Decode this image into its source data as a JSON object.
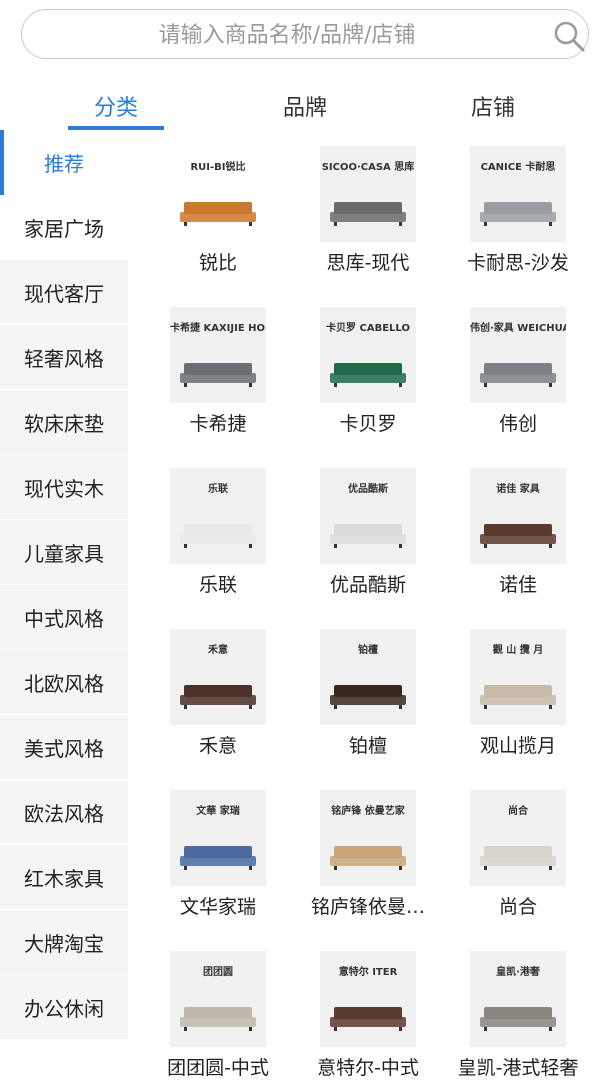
{
  "search": {
    "placeholder": "请输入商品名称/品牌/店铺",
    "value": ""
  },
  "tabs": [
    {
      "label": "分类",
      "active": true
    },
    {
      "label": "品牌",
      "active": false
    },
    {
      "label": "店铺",
      "active": false
    }
  ],
  "colors": {
    "accent": "#2d7bd6",
    "sidebar_bg": "#f5f5f5",
    "thumb_bg": "#f1f1f1"
  },
  "sidebar": {
    "items": [
      {
        "label": "推荐"
      },
      {
        "label": "家居广场"
      },
      {
        "label": "现代客厅"
      },
      {
        "label": "轻奢风格"
      },
      {
        "label": "软床床垫"
      },
      {
        "label": "现代实木"
      },
      {
        "label": "儿童家具"
      },
      {
        "label": "中式风格"
      },
      {
        "label": "北欧风格"
      },
      {
        "label": "美式风格"
      },
      {
        "label": "欧法风格"
      },
      {
        "label": "红木家具"
      },
      {
        "label": "大牌淘宝"
      },
      {
        "label": "办公休闲"
      }
    ]
  },
  "brands": [
    {
      "name": "锐比",
      "logo": "RUI-BI锐比",
      "sofa_color": "#c9782e"
    },
    {
      "name": "思库-现代",
      "logo": "SICOO·CASA 思库",
      "sofa_color": "#6a6a6a"
    },
    {
      "name": "卡耐思-沙发",
      "logo": "CANICE 卡耐思",
      "sofa_color": "#9a9ea2"
    },
    {
      "name": "卡希捷",
      "logo": "卡希捷 KAXIJIE HOME",
      "sofa_color": "#6b6e72"
    },
    {
      "name": "卡贝罗",
      "logo": "卡贝罗 CABELLO",
      "sofa_color": "#1d6b4a"
    },
    {
      "name": "伟创",
      "logo": "伟创·家具 WEICHUANG",
      "sofa_color": "#7d8086"
    },
    {
      "name": "乐联",
      "logo": "乐联",
      "sofa_color": "#e9e9e9"
    },
    {
      "name": "优品酷斯",
      "logo": "优品酷斯",
      "sofa_color": "#dcdcdc"
    },
    {
      "name": "诺佳",
      "logo": "诺佳 家具",
      "sofa_color": "#5a3a2c"
    },
    {
      "name": "禾意",
      "logo": "禾意",
      "sofa_color": "#4a3026"
    },
    {
      "name": "铂檀",
      "logo": "铂檀",
      "sofa_color": "#3a2820"
    },
    {
      "name": "观山揽月",
      "logo": "觀 山 攬 月",
      "sofa_color": "#c9b9a8"
    },
    {
      "name": "文华家瑞",
      "logo": "文華 家瑞",
      "sofa_color": "#4a6aa0"
    },
    {
      "name": "铭庐锋依曼…",
      "logo": "铭庐锋 依曼艺家",
      "sofa_color": "#c8a478"
    },
    {
      "name": "尚合",
      "logo": "尚合",
      "sofa_color": "#d8d4cc"
    },
    {
      "name": "团团圆-中式",
      "logo": "团团圆",
      "sofa_color": "#bfb8ad"
    },
    {
      "name": "意特尔-中式",
      "logo": "意特尔 ITER",
      "sofa_color": "#5a3a2c"
    },
    {
      "name": "皇凯-港式轻奢",
      "logo": "皇凯·港奢",
      "sofa_color": "#8a8680"
    }
  ]
}
